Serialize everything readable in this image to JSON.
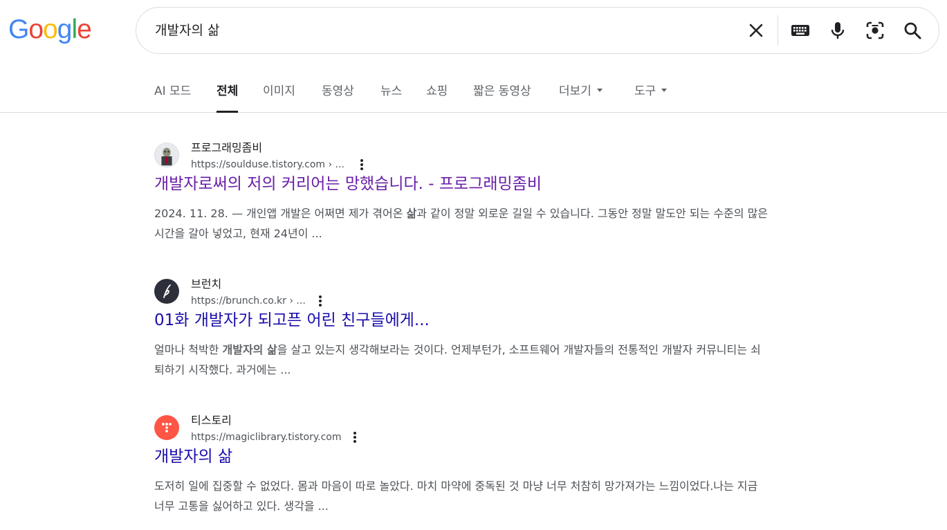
{
  "logo": {
    "text": "Google",
    "letters": [
      {
        "ch": "G",
        "color": "#4285F4"
      },
      {
        "ch": "o",
        "color": "#EA4335"
      },
      {
        "ch": "o",
        "color": "#FBBC05"
      },
      {
        "ch": "g",
        "color": "#4285F4"
      },
      {
        "ch": "l",
        "color": "#34A853"
      },
      {
        "ch": "e",
        "color": "#EA4335"
      }
    ]
  },
  "search": {
    "query": "개발자의 삶",
    "icons": [
      "close-icon",
      "keyboard-icon",
      "microphone-icon",
      "camera-lens-icon",
      "search-icon"
    ]
  },
  "tabs": [
    {
      "label": "AI 모드"
    },
    {
      "label": "전체",
      "active": true
    },
    {
      "label": "이미지"
    },
    {
      "label": "동영상"
    },
    {
      "label": "뉴스"
    },
    {
      "label": "쇼핑"
    },
    {
      "label": "짧은 동영상"
    },
    {
      "label": "더보기",
      "dropdown": true
    },
    {
      "label": "도구",
      "dropdown": true
    }
  ],
  "results": [
    {
      "site_name": "프로그래밍좀비",
      "url": "https://soulduse.tistory.com › ...",
      "title": "개발자로써의 저의 커리어는 망했습니다. - 프로그래밍좀비",
      "visited": true,
      "favicon": "zombie-avatar-icon",
      "snippet_pre": "2024. 11. 28. — 개인앱 개발은 어쩌면 제가 겪어온 ",
      "snippet_bold": "삶",
      "snippet_post": "과 같이 정말 외로운 길일 수 있습니다. 그동안 정말 말도안 되는 수준의 많은 시간을 갈아 넣었고, 현재 24년이 ..."
    },
    {
      "site_name": "브런치",
      "url": "https://brunch.co.kr › ...",
      "title": "01화 개발자가 되고픈 어린 친구들에게...",
      "visited": false,
      "favicon": "brunch-pen-icon",
      "snippet_pre": "얼마나 척박한 ",
      "snippet_bold": "개발자의 삶",
      "snippet_post": "을 살고 있는지 생각해보라는 것이다. 언제부턴가, 소프트웨어 개발자들의 전통적인 개발자 커뮤니티는 쇠퇴하기 시작했다. 과거에는 ..."
    },
    {
      "site_name": "티스토리",
      "url": "https://magiclibrary.tistory.com",
      "title": "개발자의 삶",
      "visited": false,
      "favicon": "tistory-dots-icon",
      "snippet_pre": "도저히 일에 집중할 수 없었다. 몸과 마음이 따로 놀았다. 마치 마약에 중독된 것 마냥 너무 처참히 망가져가는 느낌이었다.나는 지금 너무 고통을 싫어하고 있다. 생각을 ...",
      "snippet_bold": "",
      "snippet_post": ""
    }
  ]
}
